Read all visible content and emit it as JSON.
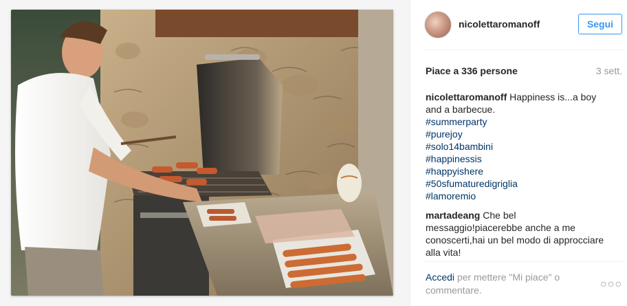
{
  "post": {
    "username": "nicolettaromanoff",
    "follow_label": "Segui",
    "likes": "Piace a 336 persone",
    "time": "3 sett."
  },
  "comments": {
    "caption": {
      "user": "nicolettaromanoff",
      "text": "Happiness is...a boy and a barbecue.",
      "hashtags": [
        "#summerparty",
        "#purejoy",
        "#solo14bambini",
        "#happinessis",
        "#happyishere",
        "#50sfumaturedigriglia",
        "#lamoremio"
      ]
    },
    "reply": {
      "user": "martadeang",
      "text": "Che bel messaggio!piacerebbe anche a me conoscerti,hai un bel modo di approcciare alla vita!"
    }
  },
  "footer": {
    "login_link": "Accedi",
    "login_text": "per mettere \"Mi piace\" o commentare."
  },
  "icons": {
    "more": "more-options-icon"
  },
  "colors": {
    "accent": "#3897f0",
    "link": "#003569",
    "muted": "#999999"
  }
}
